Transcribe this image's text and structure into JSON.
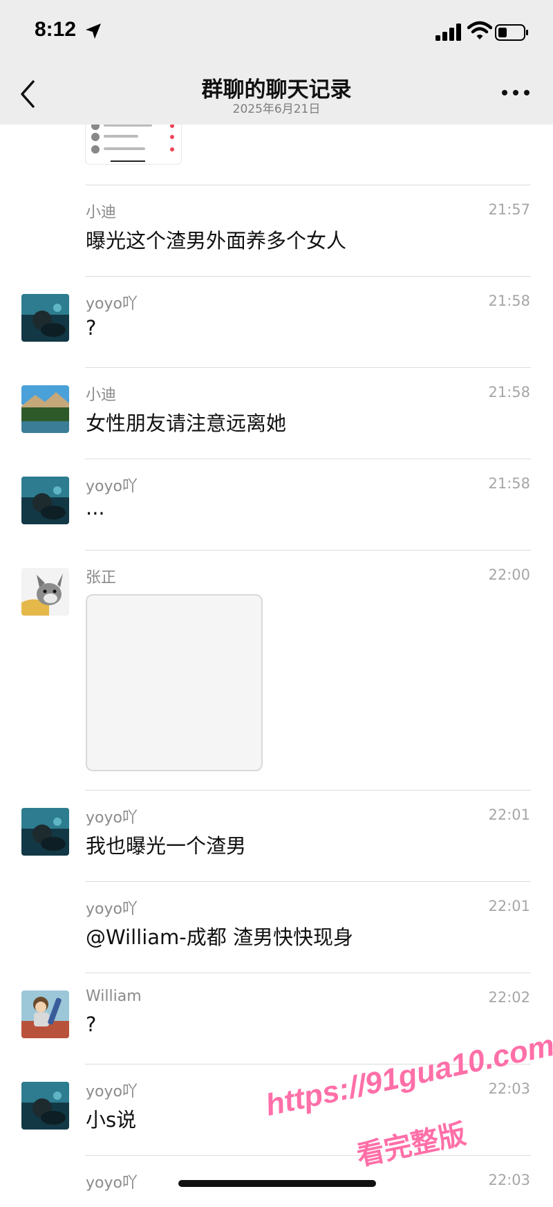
{
  "status": {
    "time": "8:12"
  },
  "header": {
    "title": "群聊的聊天记录",
    "date": "2025年6月21日"
  },
  "messages": [
    {
      "sender": "小迪",
      "time": "21:57",
      "text": "曝光这个渣男外面养多个女人",
      "avatar": "none"
    },
    {
      "sender": "yoyo吖",
      "time": "21:58",
      "text": "?",
      "avatar": "ocean"
    },
    {
      "sender": "小迪",
      "time": "21:58",
      "text": "女性朋友请注意远离她",
      "avatar": "landscape"
    },
    {
      "sender": "yoyo吖",
      "time": "21:58",
      "text": "...",
      "avatar": "ocean"
    },
    {
      "sender": "张正",
      "time": "22:00",
      "text": "",
      "avatar": "dog",
      "image": true
    },
    {
      "sender": "yoyo吖",
      "time": "22:01",
      "text": "我也曝光一个渣男",
      "avatar": "ocean"
    },
    {
      "sender": "yoyo吖",
      "time": "22:01",
      "text": "@William-成都 渣男快快现身",
      "avatar": "none"
    },
    {
      "sender": "William",
      "time": "22:02",
      "text": "?",
      "avatar": "cartoon"
    },
    {
      "sender": "yoyo吖",
      "time": "22:03",
      "text": "小s说",
      "avatar": "ocean"
    },
    {
      "sender": "yoyo吖",
      "time": "22:03",
      "text": "",
      "avatar": "none"
    }
  ],
  "watermark": {
    "line1": "https://91gua10.com",
    "line2": "看完整版"
  },
  "colors": {
    "header_bg": "#ededed",
    "watermark": "#ff6fa8"
  },
  "icons": [
    "location-arrow-icon",
    "signal-icon",
    "wifi-icon",
    "battery-icon",
    "back-chevron-icon",
    "more-dots-icon"
  ]
}
